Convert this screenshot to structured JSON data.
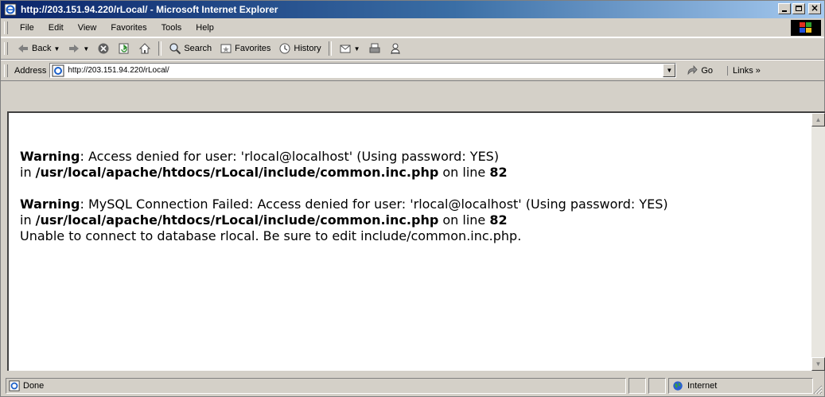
{
  "window": {
    "title": "http://203.151.94.220/rLocal/ - Microsoft Internet Explorer"
  },
  "menu": {
    "items": [
      "File",
      "Edit",
      "View",
      "Favorites",
      "Tools",
      "Help"
    ]
  },
  "toolbar": {
    "back_label": "Back",
    "search_label": "Search",
    "favorites_label": "Favorites",
    "history_label": "History"
  },
  "address": {
    "label": "Address",
    "url": "http://203.151.94.220/rLocal/",
    "go_label": "Go",
    "links_label": "Links »"
  },
  "page": {
    "w1_title": "Warning",
    "w1_text": ": Access denied for user: 'rlocal@localhost' (Using password: YES)",
    "w1_in": "in ",
    "w1_path": "/usr/local/apache/htdocs/rLocal/include/common.inc.php",
    "w1_online": " on line ",
    "w1_line": "82",
    "w2_title": "Warning",
    "w2_text": ": MySQL Connection Failed: Access denied for user: 'rlocal@localhost' (Using password: YES)",
    "w2_in": "in ",
    "w2_path": "/usr/local/apache/htdocs/rLocal/include/common.inc.php",
    "w2_online": " on line ",
    "w2_line": "82",
    "message": "Unable to connect to database rlocal. Be sure to edit include/common.inc.php."
  },
  "status": {
    "text": "Done",
    "zone": "Internet"
  },
  "icons": {
    "title": "ie-page-icon",
    "back": "back-arrow-icon",
    "forward": "forward-arrow-icon",
    "stop": "stop-icon",
    "refresh": "refresh-icon",
    "home": "home-icon",
    "search": "search-icon",
    "favorites": "favorites-icon",
    "history": "history-icon",
    "mail": "mail-icon",
    "print": "print-icon",
    "messenger": "messenger-icon",
    "go": "go-arrow-icon",
    "zone": "globe-icon"
  }
}
